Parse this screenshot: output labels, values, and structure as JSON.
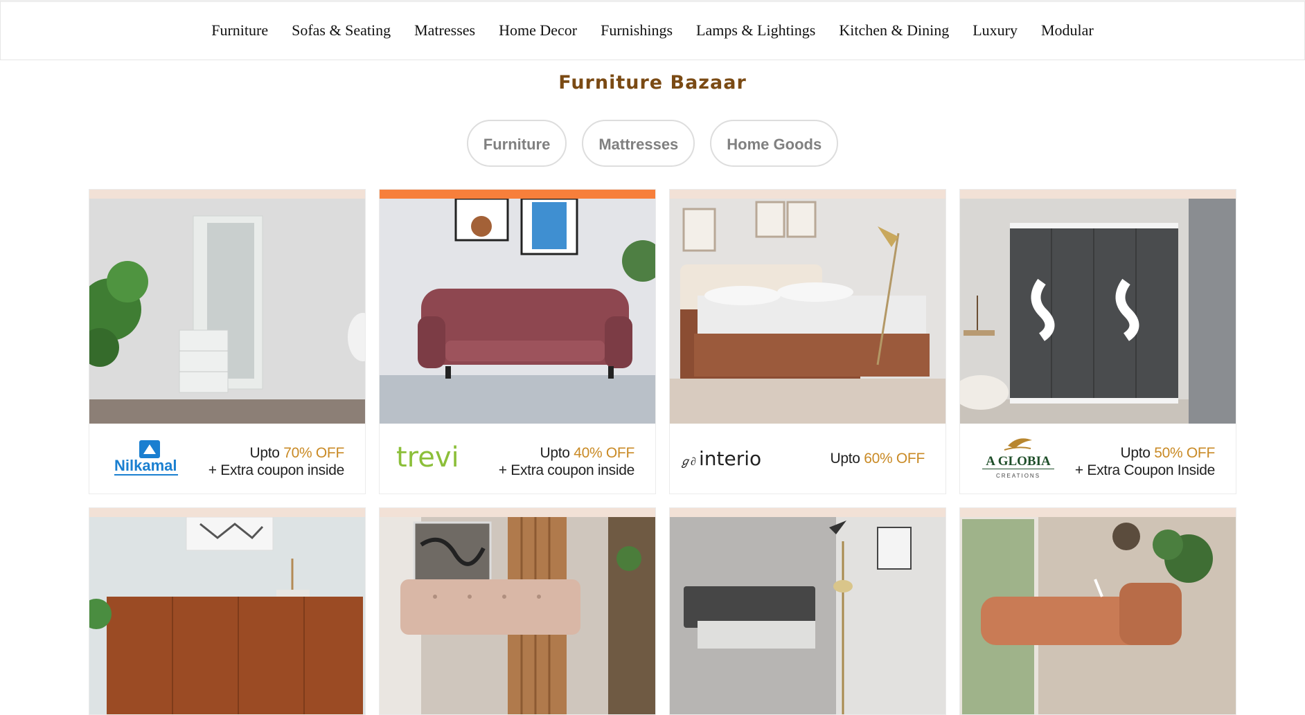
{
  "nav": {
    "items": [
      "Furniture",
      "Sofas & Seating",
      "Matresses",
      "Home Decor",
      "Furnishings",
      "Lamps & Lightings",
      "Kitchen & Dining",
      "Luxury",
      "Modular"
    ]
  },
  "section": {
    "title": "Furniture Bazaar"
  },
  "pills": [
    "Furniture",
    "Mattresses",
    "Home Goods"
  ],
  "cards": [
    {
      "brand": "Nilkamal",
      "offer_prefix": "Upto ",
      "offer_pct": "70% OFF",
      "offer_extra": "+ Extra coupon inside"
    },
    {
      "brand": "trevi",
      "offer_prefix": "Upto ",
      "offer_pct": "40% OFF",
      "offer_extra": "+ Extra coupon inside"
    },
    {
      "brand": "interio",
      "offer_prefix": "Upto ",
      "offer_pct": "60% OFF",
      "offer_extra": ""
    },
    {
      "brand": "A GLOBIA",
      "brand_sub": "CREATIONS",
      "offer_prefix": "Upto ",
      "offer_pct": "50% OFF",
      "offer_extra": "+ Extra Coupon Inside"
    }
  ],
  "colors": {
    "title": "#7a4a14",
    "offer_accent": "#c98a25",
    "strip": "#f2e1d6",
    "strip_active": "#f77f3b",
    "nilkamal_blue": "#1a7fd0",
    "trevi_green": "#8cbf3a"
  }
}
